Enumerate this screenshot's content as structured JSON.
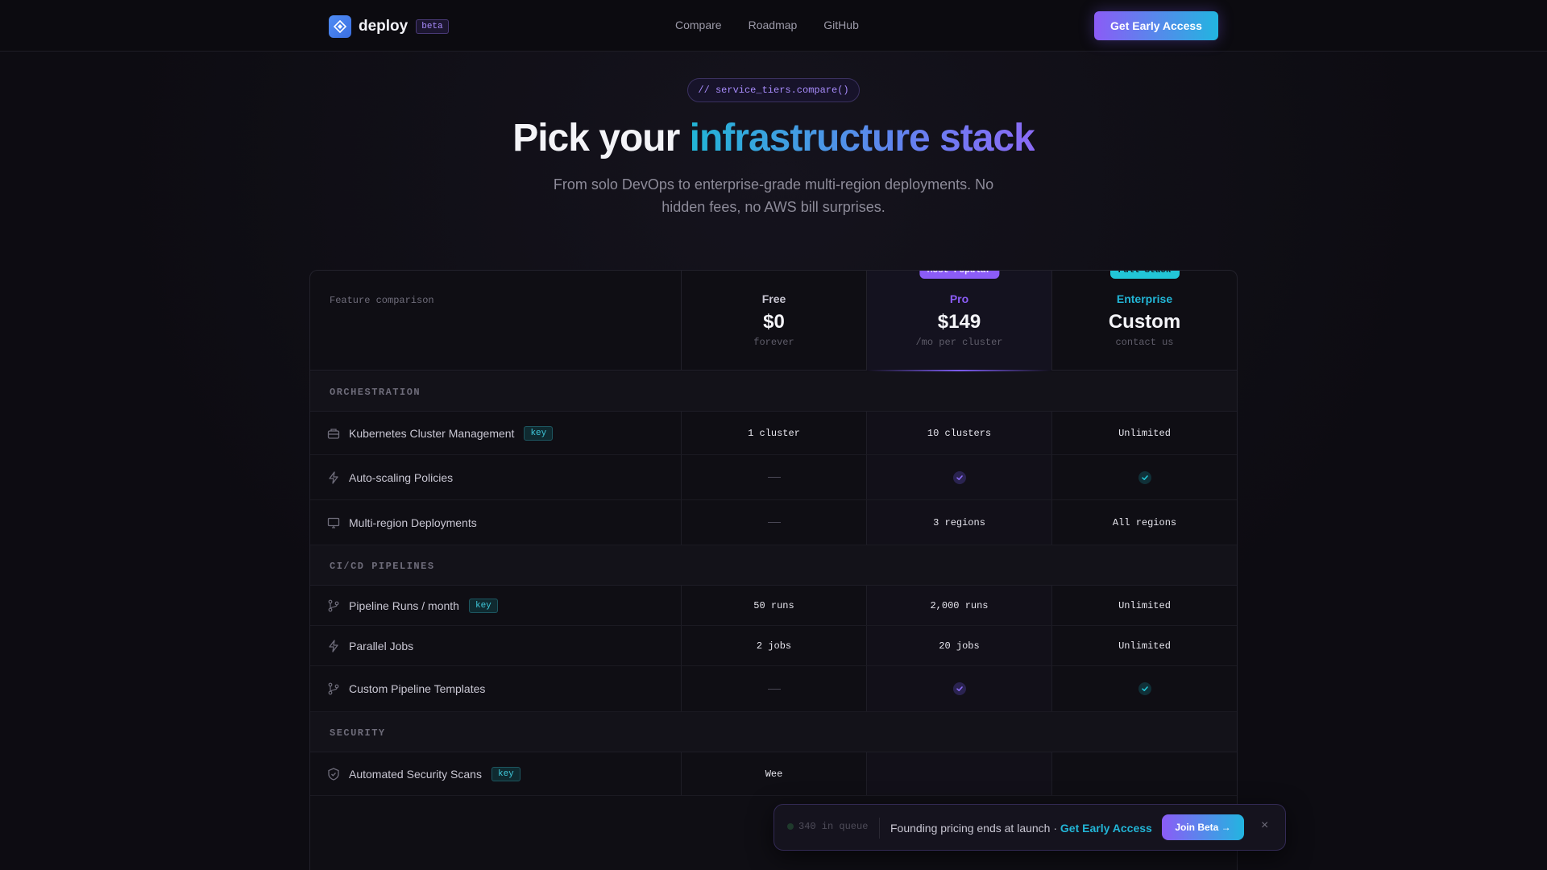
{
  "nav": {
    "brand": "deploy",
    "beta": "beta",
    "links": [
      "Compare",
      "Roadmap",
      "GitHub"
    ],
    "cta": "Get Early Access"
  },
  "hero": {
    "code_pill": "// service_tiers.compare()",
    "title_plain": "Pick your ",
    "title_accent": "infrastructure stack",
    "subtitle": "From solo DevOps to enterprise-grade multi-region deployments. No hidden fees, no AWS bill surprises."
  },
  "table": {
    "header_label": "Feature comparison",
    "tiers": [
      {
        "name": "Free",
        "price": "$0",
        "note": "forever",
        "color": "#c9c7d3",
        "badge": ""
      },
      {
        "name": "Pro",
        "price": "$149",
        "note": "/mo per cluster",
        "color": "#8b5cf6",
        "badge": "Most Popular"
      },
      {
        "name": "Enterprise",
        "price": "Custom",
        "note": "contact us",
        "color": "#22b5d6",
        "badge": "Full Stack"
      }
    ],
    "sections": [
      {
        "label": "ORCHESTRATION",
        "rows": [
          {
            "feature": "Kubernetes Cluster Management",
            "icon": "cluster-icon",
            "key": "key",
            "free": "1 cluster",
            "pro": "10 clusters",
            "enterprise": "Unlimited"
          },
          {
            "feature": "Auto-scaling Policies",
            "icon": "bolt-icon",
            "key": "",
            "free": "—",
            "pro": "✓",
            "enterprise": "✓"
          },
          {
            "feature": "Multi-region Deployments",
            "icon": "monitor-icon",
            "key": "",
            "free": "—",
            "pro": "3 regions",
            "enterprise": "All regions"
          }
        ]
      },
      {
        "label": "CI/CD PIPELINES",
        "rows": [
          {
            "feature": "Pipeline Runs / month",
            "icon": "branch-icon",
            "key": "key",
            "free": "50 runs",
            "pro": "2,000 runs",
            "enterprise": "Unlimited"
          },
          {
            "feature": "Parallel Jobs",
            "icon": "bolt-icon",
            "key": "",
            "free": "2 jobs",
            "pro": "20 jobs",
            "enterprise": "Unlimited"
          },
          {
            "feature": "Custom Pipeline Templates",
            "icon": "branch-icon",
            "key": "",
            "free": "—",
            "pro": "✓",
            "enterprise": "✓"
          }
        ]
      },
      {
        "label": "SECURITY",
        "rows": [
          {
            "feature": "Automated Security Scans",
            "icon": "shield-icon",
            "key": "key",
            "free": "Wee",
            "pro": "",
            "enterprise": ""
          }
        ]
      }
    ]
  },
  "toast": {
    "queue": "340 in queue",
    "message": "Founding pricing ends at launch · ",
    "link": "Get Early Access",
    "button": "Join Beta →",
    "close": "×"
  }
}
